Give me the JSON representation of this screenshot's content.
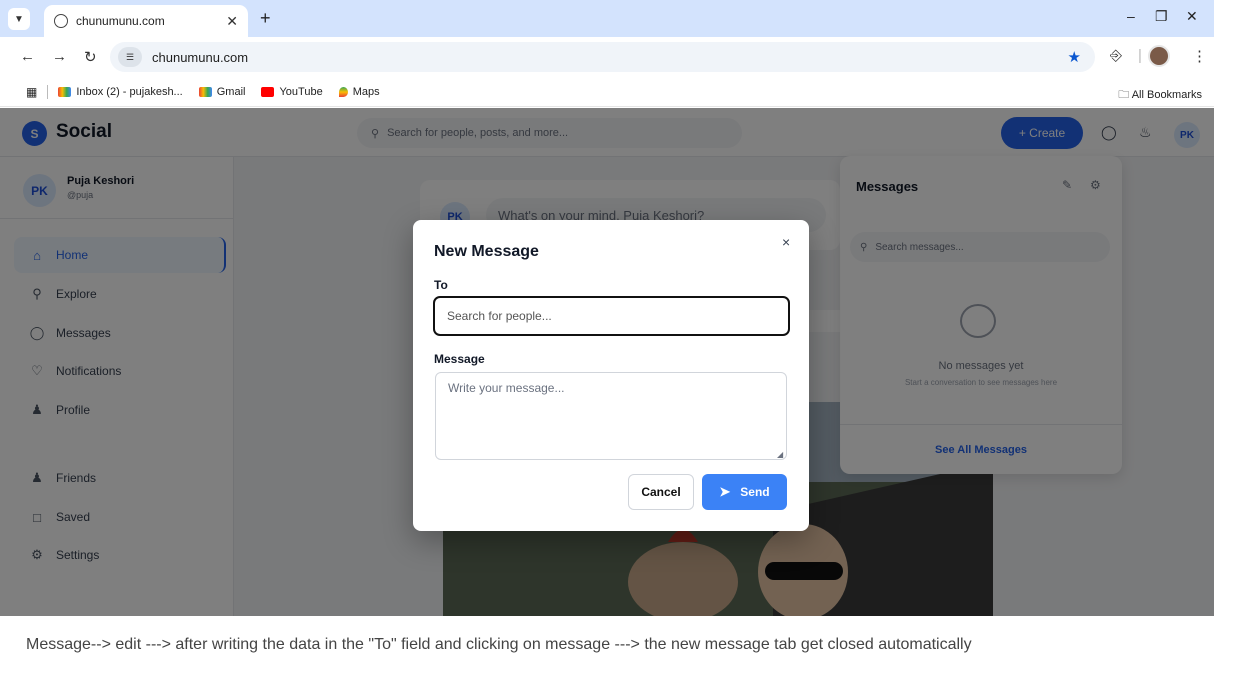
{
  "browser": {
    "tab_title": "chunumunu.com",
    "url": "chunumunu.com",
    "bookmarks": [
      "Inbox (2) - pujakesh...",
      "Gmail",
      "YouTube",
      "Maps"
    ],
    "all_bookmarks": "All Bookmarks"
  },
  "app": {
    "logo_letter": "S",
    "logo_text": "Social",
    "search_placeholder": "Search for people, posts, and more...",
    "create_label": "+ Create",
    "avatar": "PK"
  },
  "sidebar": {
    "user_initials": "PK",
    "user_name": "Puja Keshori",
    "user_handle": "@puja",
    "items": [
      {
        "label": "Home",
        "icon": "home-icon"
      },
      {
        "label": "Explore",
        "icon": "search-icon"
      },
      {
        "label": "Messages",
        "icon": "chat-icon"
      },
      {
        "label": "Notifications",
        "icon": "heart-icon"
      },
      {
        "label": "Profile",
        "icon": "user-icon"
      },
      {
        "label": "Friends",
        "icon": "users-icon"
      },
      {
        "label": "Saved",
        "icon": "bookmark-icon"
      },
      {
        "label": "Settings",
        "icon": "gear-icon"
      }
    ]
  },
  "feed": {
    "avatar": "PK",
    "prompt": "What's on your mind, Puja Keshori?"
  },
  "messages_panel": {
    "title": "Messages",
    "search_placeholder": "Search messages...",
    "empty_title": "No messages yet",
    "empty_sub": "Start a conversation to see messages here",
    "footer": "See All Messages"
  },
  "modal": {
    "title": "New Message",
    "close": "×",
    "to_label": "To",
    "to_placeholder": "Search for people...",
    "message_label": "Message",
    "message_placeholder": "Write your message...",
    "cancel": "Cancel",
    "send": "Send"
  },
  "caption": "Message--> edit ---> after writing the data in the \"To\" field and clicking on message ---> the new message tab get closed automatically"
}
